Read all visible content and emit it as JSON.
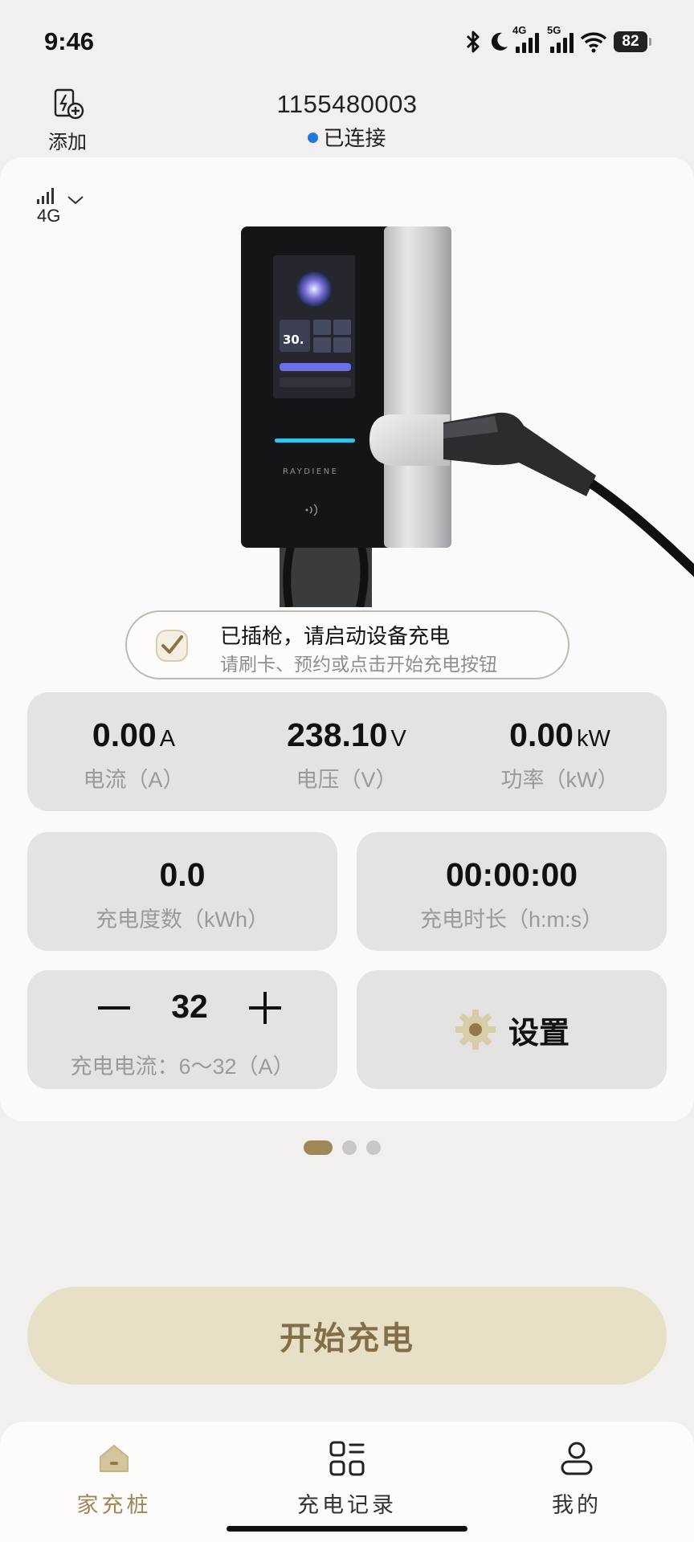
{
  "status_bar": {
    "time": "9:46",
    "net1": "4G",
    "net2": "5G",
    "battery": "82"
  },
  "header": {
    "add_label": "添加",
    "device_id": "1155480003",
    "connection_status": "已连接",
    "connection_color": "#1f7ae0"
  },
  "network": {
    "label": "4G"
  },
  "charger": {
    "brand": "RAYDIENE",
    "screen_value": "30."
  },
  "status_pill": {
    "title": "已插枪，请启动设备充电",
    "subtitle": "请刷卡、预约或点击开始充电按钮"
  },
  "metrics": {
    "current": {
      "value": "0.00",
      "unit": "A",
      "label": "电流（A）"
    },
    "voltage": {
      "value": "238.10",
      "unit": "V",
      "label": "电压（V）"
    },
    "power": {
      "value": "0.00",
      "unit": "kW",
      "label": "功率（kW）"
    },
    "energy": {
      "value": "0.0",
      "label": "充电度数（kWh）"
    },
    "duration": {
      "value": "00:00:00",
      "label": "充电时长（h:m:s）"
    }
  },
  "current_setting": {
    "value": "32",
    "label": "充电电流：6～32（A）"
  },
  "settings": {
    "label": "设置"
  },
  "pager": {
    "pages": 3,
    "active": 0
  },
  "start_button": {
    "label": "开始充电",
    "bg_color": "#e8dfc7",
    "text_color": "#826f48"
  },
  "bottom_nav": {
    "items": [
      {
        "label": "家充桩",
        "active": true
      },
      {
        "label": "充电记录",
        "active": false
      },
      {
        "label": "我的",
        "active": false
      }
    ],
    "active_color": "#a08758"
  }
}
